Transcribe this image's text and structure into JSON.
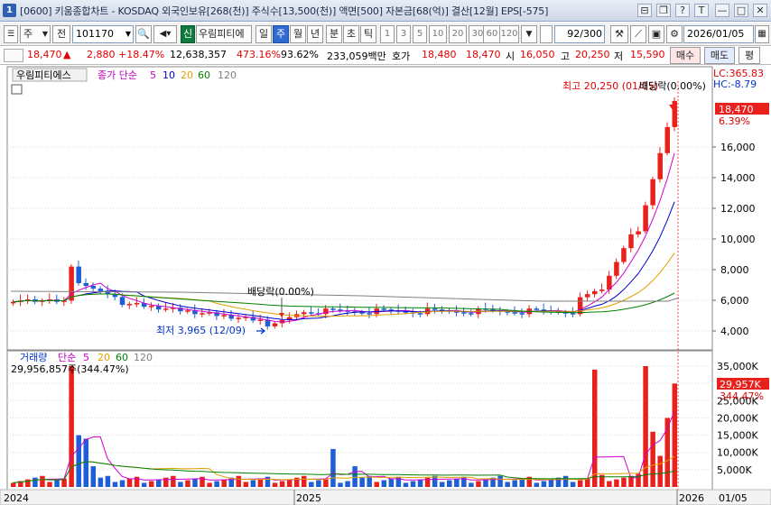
{
  "titlebar": {
    "win_num": "1",
    "title": "[0600] 키움종합차트 - KOSDAQ 외국인보유[268(천)] 주식수[13,500(천)] 액면[500] 자본금[68(억)] 결산[12월] EPS[-575]",
    "buttons": [
      "⊟",
      "❐",
      "?",
      "T",
      "—",
      "□",
      "✕"
    ]
  },
  "toolbar": {
    "period": "주",
    "prev": "전",
    "code": "101170",
    "badge": "신",
    "stock_name": "우림피티에",
    "tabs": [
      "일",
      "주",
      "월",
      "년",
      "분",
      "초",
      "틱"
    ],
    "selected_tab": "주",
    "intervals": [
      "1",
      "3",
      "5",
      "10",
      "20",
      "30",
      "60",
      "120"
    ],
    "count": "92",
    "count_max": "/300",
    "date": "2026/01/05"
  },
  "quote": {
    "price": "18,470",
    "arrow": "▲",
    "change": "2,880",
    "change_pct": "+18.47%",
    "volume": "12,638,357",
    "vol_ratio": "473.16%",
    "ratio2": "93.62%",
    "amount": "233,059백만",
    "hoga_label": "호가",
    "hoga1": "18,480",
    "hoga2": "18,470",
    "open_label": "시",
    "open": "16,050",
    "high_label": "고",
    "high": "20,250",
    "low_label": "저",
    "low": "15,590",
    "buy": "매수",
    "sell": "매도",
    "even": "평"
  },
  "price_panel": {
    "legend_name": "우림피티에스",
    "legend_ma_label": "종가 단순",
    "ma": [
      {
        "period": "5",
        "color": "#d000d0"
      },
      {
        "period": "10",
        "color": "#0000cc"
      },
      {
        "period": "20",
        "color": "#e0a000"
      },
      {
        "period": "60",
        "color": "#008000"
      },
      {
        "period": "120",
        "color": "#808080"
      }
    ],
    "lc": "LC:365.83",
    "hc": "HC:-8.79",
    "high_note": "최고 20,250 (01/05)",
    "div_note_top": "배당락(0.00%)",
    "div_note_mid": "배당락(0.00%)",
    "low_note": "최저 3,965 (12/09)",
    "last_price": "18,470",
    "last_pct": "6.39%",
    "y_ticks": [
      "16,000",
      "14,000",
      "12,000",
      "10,000",
      "8,000",
      "6,000",
      "4,000"
    ]
  },
  "volume_panel": {
    "legend_name": "거래량",
    "legend_ma_label": "단순",
    "ma": [
      {
        "period": "5",
        "color": "#d000d0"
      },
      {
        "period": "20",
        "color": "#e0a000"
      },
      {
        "period": "60",
        "color": "#008000"
      },
      {
        "period": "120",
        "color": "#808080"
      }
    ],
    "vol_info": "29,956,857주(344.47%)",
    "last_vol": "29,957K",
    "last_pct": "344.47%",
    "y_ticks": [
      "35,000K",
      "30,000K",
      "25,000K",
      "20,000K",
      "15,000K",
      "10,000K",
      "5,000K"
    ]
  },
  "x_axis": {
    "labels": [
      "2024",
      "2025",
      "2026"
    ],
    "cursor_date": "01/05"
  },
  "colors": {
    "up": "#e8211d",
    "down": "#1f5fd6",
    "grid": "#d8d8d8",
    "price_tag": "#e8211d"
  }
}
